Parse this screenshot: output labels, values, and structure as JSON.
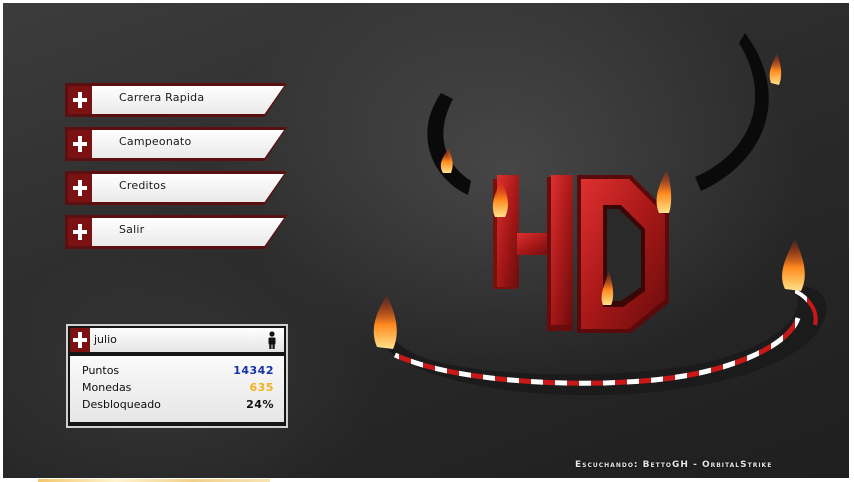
{
  "menu": {
    "items": [
      {
        "label": "Carrera Rapida"
      },
      {
        "label": "Campeonato"
      },
      {
        "label": "Creditos"
      },
      {
        "label": "Salir"
      }
    ]
  },
  "player": {
    "name": "julio",
    "stats": [
      {
        "label": "Puntos",
        "value": "14342",
        "color": "#1432a8"
      },
      {
        "label": "Monedas",
        "value": "635",
        "color": "#f0b020"
      },
      {
        "label": "Desbloqueado",
        "value": "24%",
        "color": "#111111"
      }
    ]
  },
  "logo": {
    "text": "HD"
  },
  "footer": {
    "credit": "Escuchando: BettoGH - OrbitalStrike"
  },
  "colors": {
    "accent": "#7a1213",
    "frame": "#5c0f10",
    "track_red": "#c81818"
  }
}
